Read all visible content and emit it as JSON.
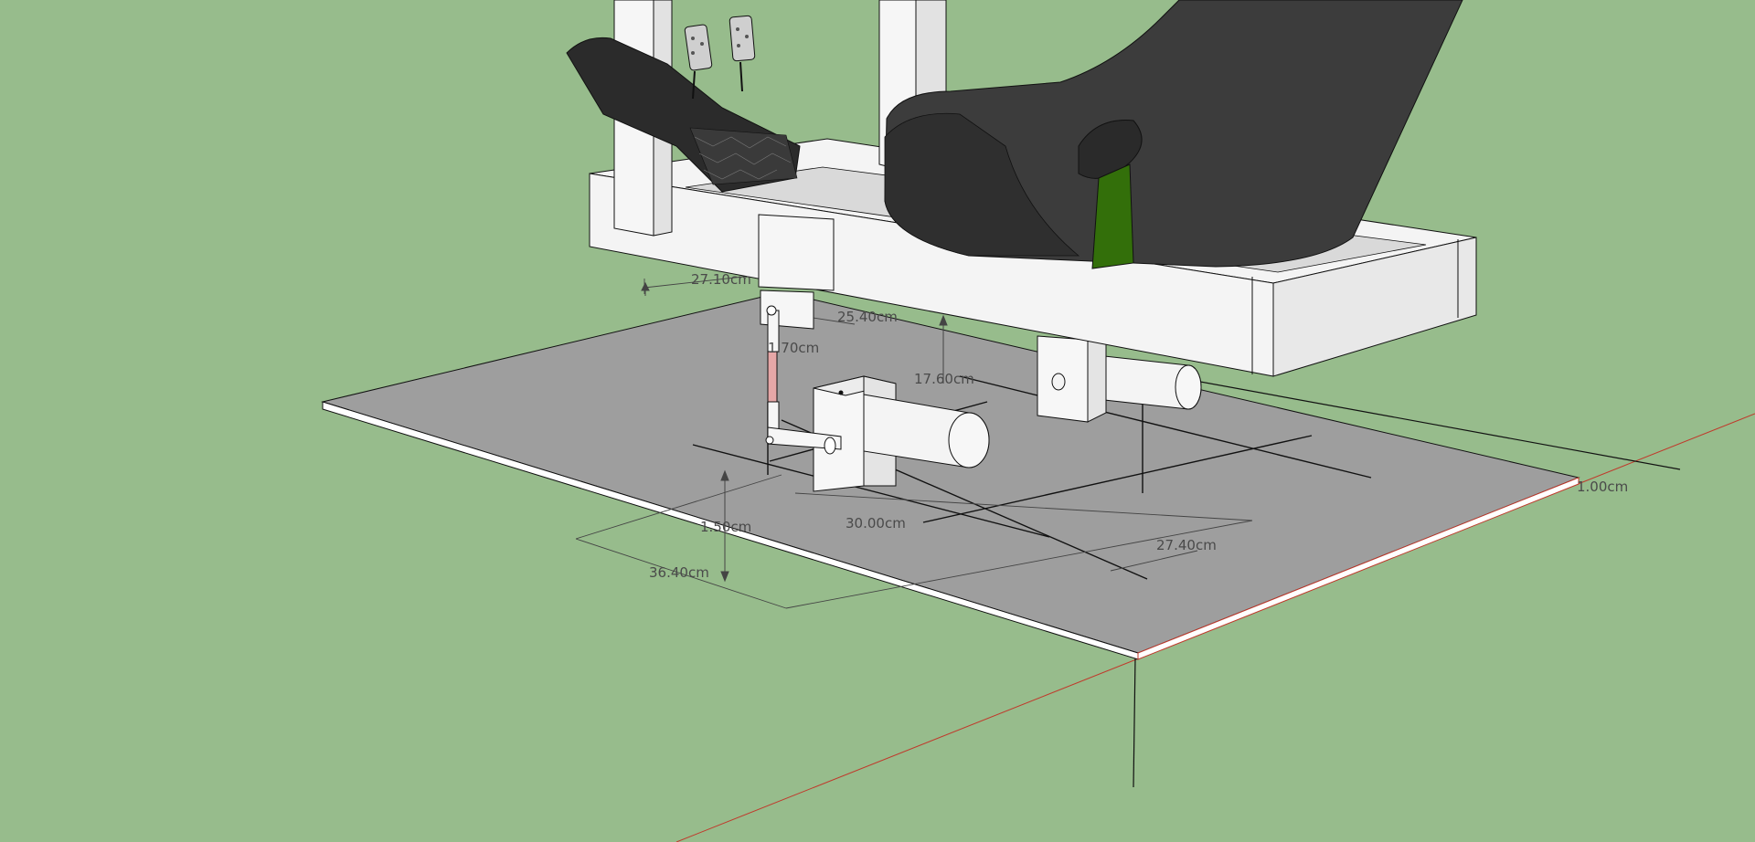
{
  "app": {
    "name": "3D modeling viewport",
    "view": "perspective"
  },
  "colors": {
    "ground": "#97bc8c",
    "base_plate": "#9e9e9e",
    "base_plate_edge": "#ffffff",
    "frame": "#f4f4f4",
    "seat": "#3c3c3c",
    "seat_strap": "#336f0a",
    "axis_red": "#c0392b",
    "link_rod": "#e6a7a7",
    "edge": "#111111",
    "dimension_text": "#4a4a4a"
  },
  "model": {
    "objects": [
      "base-plate",
      "seat-frame",
      "racing-seat",
      "pedal-set",
      "linear-actuator-front",
      "linear-actuator-rear",
      "linkage-arm"
    ]
  },
  "dimensions": {
    "d_27_10": "27.10cm",
    "d_25_40": "25.40cm",
    "d_1_70": "1.70cm",
    "d_17_60": "17.60cm",
    "d_1_50": "1.50cm",
    "d_30_00": "30.00cm",
    "d_27_40": "27.40cm",
    "d_36_40": "36.40cm",
    "d_1_00": "1.00cm"
  },
  "icons": [
    "measure-arrow-icon"
  ]
}
